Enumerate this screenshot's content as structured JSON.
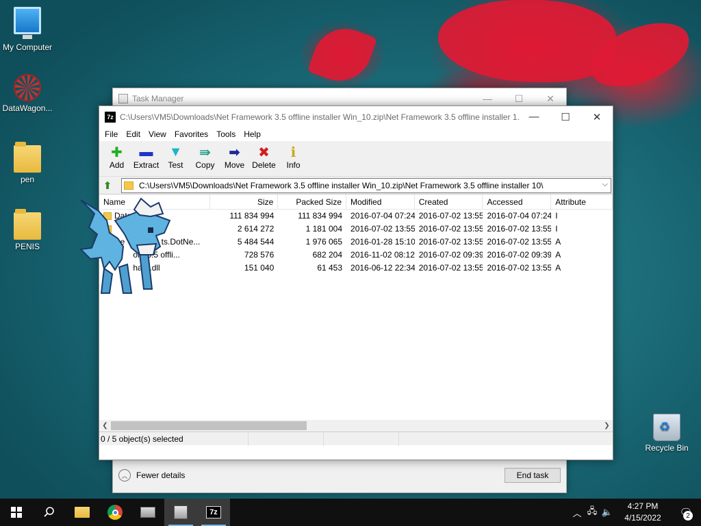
{
  "desktop": {
    "icons": [
      {
        "label": "My Computer",
        "icon": "monitor-icon"
      },
      {
        "label": "DataWagon...",
        "icon": "datawagon-icon"
      },
      {
        "label": "pen",
        "icon": "folder-icon"
      },
      {
        "label": "PENIS",
        "icon": "folder-icon"
      },
      {
        "label": "Recycle Bin",
        "icon": "recycle-bin-icon"
      }
    ]
  },
  "task_manager": {
    "title": "Task Manager",
    "fewer_details": "Fewer details",
    "end_task": "End task"
  },
  "sevenzip": {
    "app_icon_text": "7z",
    "title": "C:\\Users\\VM5\\Downloads\\Net Framework 3.5 offline installer Win_10.zip\\Net Framework 3.5 offline installer 1...",
    "menu": [
      "File",
      "Edit",
      "View",
      "Favorites",
      "Tools",
      "Help"
    ],
    "toolbar": [
      {
        "label": "Add",
        "icon": "plus-icon",
        "color": "#1fae1f"
      },
      {
        "label": "Extract",
        "icon": "minus-icon",
        "color": "#1f35c8"
      },
      {
        "label": "Test",
        "icon": "check-icon",
        "color": "#1fb5c8"
      },
      {
        "label": "Copy",
        "icon": "double-arrow-icon",
        "color": "#1f9a8a"
      },
      {
        "label": "Move",
        "icon": "arrow-right-icon",
        "color": "#1f2a9a"
      },
      {
        "label": "Delete",
        "icon": "x-icon",
        "color": "#d21f1f"
      },
      {
        "label": "Info",
        "icon": "info-icon",
        "color": "#c8a81f"
      }
    ],
    "address": "C:\\Users\\VM5\\Downloads\\Net Framework 3.5 offline installer Win_10.zip\\Net Framework 3.5 offline installer 10\\",
    "columns": [
      "Name",
      "Size",
      "Packed Size",
      "Modified",
      "Created",
      "Accessed",
      "Attribute"
    ],
    "rows": [
      {
        "name": "Data",
        "type": "folder",
        "size": "111 834 994",
        "packed": "111 834 994",
        "modified": "2016-07-04 07:24",
        "created": "2016-07-02 13:55",
        "accessed": "2016-07-04 07:24",
        "attr": "I"
      },
      {
        "name": "",
        "type": "folder",
        "size": "2 614 272",
        "packed": "1 181 004",
        "modified": "2016-07-02 13:55",
        "created": "2016-07-02 13:55",
        "accessed": "2016-07-02 13:55",
        "attr": "I"
      },
      {
        "name": "De                ts.DotNe...",
        "type": "file",
        "size": "5 484 544",
        "packed": "1 976 065",
        "modified": "2016-01-28 15:10",
        "created": "2016-07-02 13:55",
        "accessed": "2016-07-02 13:55",
        "attr": "A"
      },
      {
        "name": "             ork 3.5 offli...",
        "type": "none",
        "size": "728 576",
        "packed": "682 204",
        "modified": "2016-11-02 08:12",
        "created": "2016-07-02 09:39",
        "accessed": "2016-07-02 09:39",
        "attr": "A"
      },
      {
        "name": "             harp.dll",
        "type": "none",
        "size": "151 040",
        "packed": "61 453",
        "modified": "2016-06-12 22:34",
        "created": "2016-07-02 13:55",
        "accessed": "2016-07-02 13:55",
        "attr": "A"
      }
    ],
    "status": "0 / 5 object(s) selected"
  },
  "taskbar": {
    "apps": [
      {
        "name": "start-button",
        "icon": "windows-icon"
      },
      {
        "name": "search-button",
        "icon": "search-icon"
      },
      {
        "name": "file-explorer-button",
        "icon": "folder-icon"
      },
      {
        "name": "chrome-button",
        "icon": "chrome-icon"
      },
      {
        "name": "computer-button",
        "icon": "computer-icon"
      },
      {
        "name": "task-manager-button",
        "icon": "task-manager-icon"
      },
      {
        "name": "sevenzip-button",
        "icon": "sevenzip-icon",
        "text": "7z"
      }
    ],
    "time": "4:27 PM",
    "date": "4/15/2022",
    "notifications": "2"
  }
}
